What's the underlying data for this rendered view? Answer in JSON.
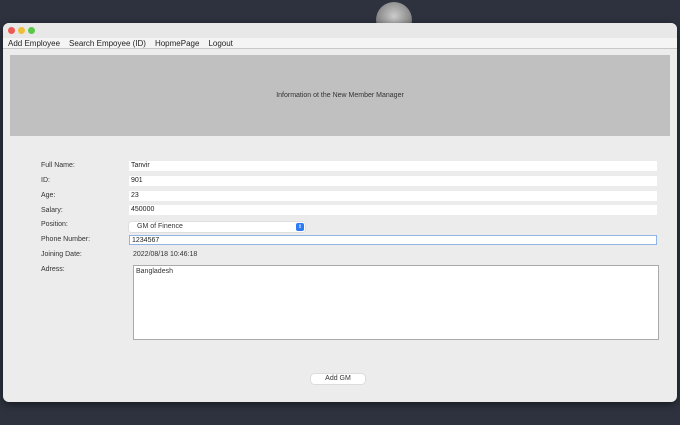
{
  "menu": [
    "Add Employee",
    "Search Empoyee (ID)",
    "HopmePage",
    "Logout"
  ],
  "banner": "Information ot the New Member Manager",
  "labels": {
    "name": "Full Name:",
    "id": "ID:",
    "age": "Age:",
    "salary": "Salary:",
    "position": "Position:",
    "phone": "Phone Number:",
    "joining": "Joining Date:",
    "address": "Adress:"
  },
  "values": {
    "name": "Tanvir",
    "id": "901",
    "age": "23",
    "salary": "450000",
    "position": "GM of Finence",
    "phone": "1234567",
    "joining": "2022/08/18 10:46:18",
    "address": "Bangladesh"
  },
  "button": "Add GM"
}
